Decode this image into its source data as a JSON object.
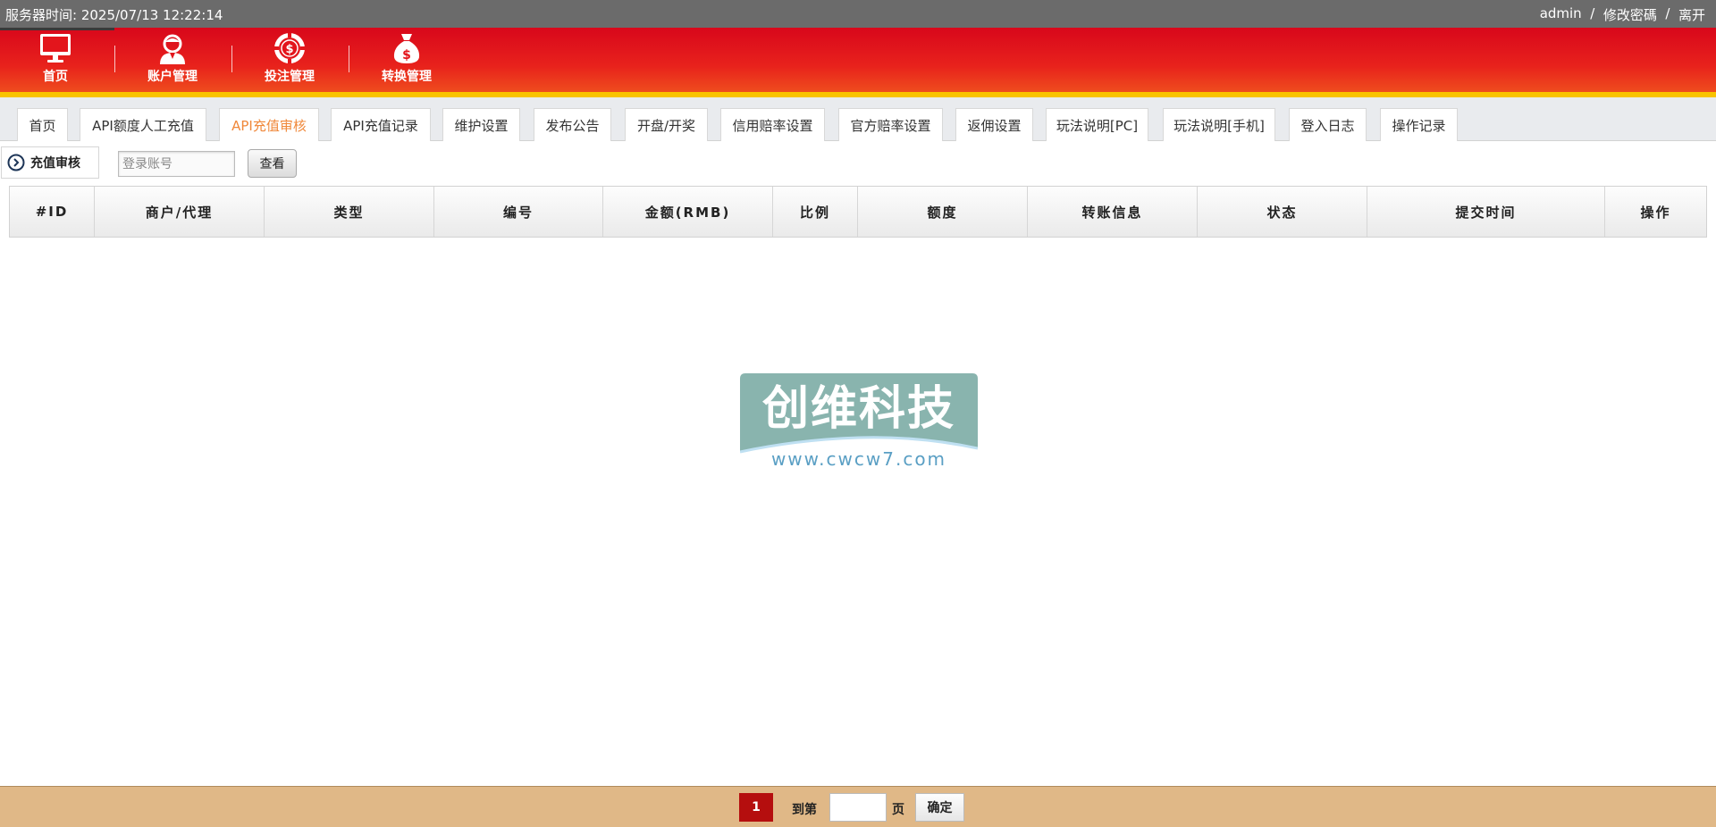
{
  "topbar": {
    "server_time": "服务器时间: 2025/07/13 12:22:14",
    "user": "admin",
    "sep1": "  /  ",
    "change_password": "修改密碼",
    "sep2": "  /  ",
    "logout": "离开"
  },
  "nav": [
    {
      "label": "首页",
      "icon": "monitor-icon"
    },
    {
      "label": "账户管理",
      "icon": "user-icon"
    },
    {
      "label": "投注管理",
      "icon": "chip-icon"
    },
    {
      "label": "转换管理",
      "icon": "money-bag-icon"
    }
  ],
  "tabs": [
    {
      "label": "首页"
    },
    {
      "label": "API额度人工充值"
    },
    {
      "label": "API充值审核",
      "active": true
    },
    {
      "label": "API充值记录"
    },
    {
      "label": "维护设置"
    },
    {
      "label": "发布公告"
    },
    {
      "label": "开盘/开奖"
    },
    {
      "label": "信用赔率设置"
    },
    {
      "label": "官方赔率设置"
    },
    {
      "label": "返佣设置"
    },
    {
      "label": "玩法说明[PC]"
    },
    {
      "label": "玩法说明[手机]"
    },
    {
      "label": "登入日志"
    },
    {
      "label": "操作记录"
    }
  ],
  "toolbar": {
    "section_title": "充值审核",
    "search_placeholder": "登录账号",
    "view_label": "查看"
  },
  "table": {
    "columns": [
      "#ID",
      "商户/代理",
      "类型",
      "编号",
      "金额(RMB)",
      "比例",
      "额度",
      "转账信息",
      "状态",
      "提交时间",
      "操作"
    ],
    "rows": []
  },
  "watermark": {
    "title": "创维科技",
    "url": "www.cwcw7.com"
  },
  "pager": {
    "current_page": "1",
    "goto_label": "到第",
    "page_unit": "页",
    "confirm_label": "确定"
  },
  "colors": {
    "header_red": "#d8071b",
    "accent_yellow": "#f9c300",
    "active_tab": "#f0883a",
    "pager_current": "#b50e0e",
    "footer_bg": "#e0b887"
  }
}
